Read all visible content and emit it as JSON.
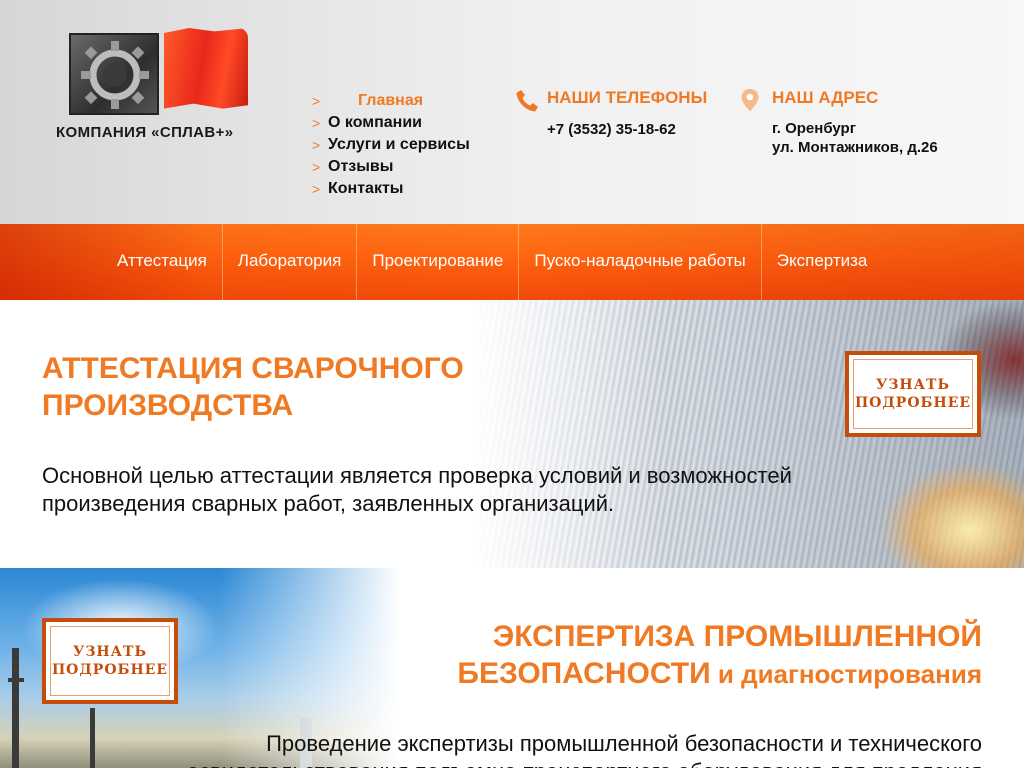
{
  "brand": {
    "logo_text": "КОМПАНИЯ «СПЛАВ+»"
  },
  "topnav": {
    "items": [
      {
        "label": "Главная",
        "active": true
      },
      {
        "label": "О компании"
      },
      {
        "label": "Услуги и сервисы"
      },
      {
        "label": "Отзывы"
      },
      {
        "label": "Контакты"
      }
    ]
  },
  "contacts": {
    "phones_title": "НАШИ ТЕЛЕФОНЫ",
    "phone": "+7 (3532) 35-18-62",
    "address_title": "НАШ АДРЕС",
    "address_line1": "г. Оренбург",
    "address_line2": "ул. Монтажников, д.26"
  },
  "mainnav": {
    "items": [
      {
        "label": "Аттестация"
      },
      {
        "label": "Лаборатория"
      },
      {
        "label": "Проектирование"
      },
      {
        "label": "Пуско-наладочные работы"
      },
      {
        "label": "Экспертиза"
      }
    ]
  },
  "section1": {
    "title_line1": "АТТЕСТАЦИЯ СВАРОЧНОГО",
    "title_line2": "ПРОИЗВОДСТВА",
    "description": "Основной целью аттестации является проверка условий и возможностей произведения сварных работ, заявленных организаций.",
    "button_line1": "УЗНАТЬ",
    "button_line2": "ПОДРОБНЕЕ"
  },
  "section2": {
    "title_line1": "ЭКСПЕРТИЗА ПРОМЫШЛЕННОЙ",
    "title_line2_main": "БЕЗОПАСНОСТИ",
    "title_line2_suffix": " и диагностирования",
    "description": "Проведение экспертизы промышленной безопасности и технического освидетельствования подъемно-транспортного оборудования для продления",
    "button_line1": "УЗНАТЬ",
    "button_line2": "ПОДРОБНЕЕ"
  },
  "colors": {
    "accent": "#f07a24",
    "nav_bar": "#ff6410",
    "button_border": "#c44d0a"
  },
  "icons": [
    "gear-logo-icon",
    "flag-logo-icon",
    "chevron-right-icon",
    "phone-icon",
    "map-pin-icon"
  ]
}
